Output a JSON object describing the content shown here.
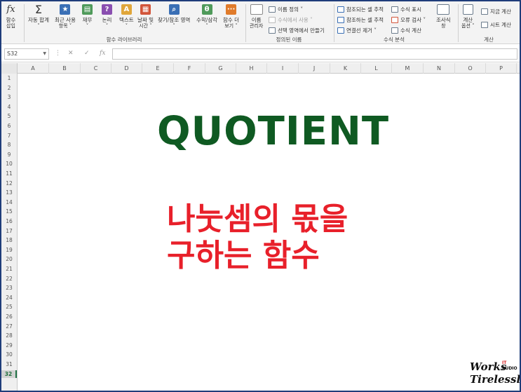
{
  "ribbon": {
    "function_library": {
      "insert_function": {
        "icon_label": "fx",
        "line1": "함수",
        "line2": "삽입"
      },
      "autosum": {
        "icon_label": "Σ",
        "line1": "자동 합계",
        "line2": "˅"
      },
      "recent": {
        "line1": "최근 사용",
        "line2": "항목 ˅"
      },
      "financial": {
        "line1": "재무",
        "line2": "˅"
      },
      "logical": {
        "icon_label": "?",
        "line1": "논리",
        "line2": "˅"
      },
      "text": {
        "line1": "텍스트",
        "line2": "˅"
      },
      "datetime": {
        "line1": "날짜 및",
        "line2": "시간 ˅"
      },
      "lookup": {
        "line1": "찾기/참조 영역",
        "line2": "˅"
      },
      "math": {
        "icon_label": "θ",
        "line1": "수학/삼각",
        "line2": "˅"
      },
      "more": {
        "line1": "함수 더",
        "line2": "보기 ˅"
      },
      "group_label": "함수 라이브러리"
    },
    "defined_names": {
      "name_manager": {
        "line1": "이름",
        "line2": "관리자"
      },
      "define_name": "이름 정의 ˅",
      "use_in_formula": "수식에서 사용 ˅",
      "create_from_selection": "선택 영역에서 만들기",
      "group_label": "정의된 이름"
    },
    "formula_auditing": {
      "trace_precedents": "참조되는 셀 추적",
      "trace_dependents": "참조하는 셀 추적",
      "remove_arrows": "연결선 제거 ˅",
      "show_formulas": "수식 표시",
      "error_checking": "오류 검사 ˅",
      "evaluate_formula": "수식 계산",
      "watch_window": {
        "line1": "조사식",
        "line2": "창"
      },
      "group_label": "수식 분석"
    },
    "calculation": {
      "calc_options": {
        "line1": "계산",
        "line2": "옵션 ˅"
      },
      "calc_now": "지금 계산",
      "calc_sheet": "시트 계산",
      "group_label": "계산"
    }
  },
  "formula_bar": {
    "name_box": "S32",
    "cancel_icon": "✕",
    "enter_icon": "✓",
    "fx_icon": "fx",
    "formula": ""
  },
  "columns": [
    "A",
    "B",
    "C",
    "D",
    "E",
    "F",
    "G",
    "H",
    "I",
    "J",
    "K",
    "L",
    "M",
    "N",
    "O",
    "P"
  ],
  "rows": [
    "1",
    "2",
    "3",
    "4",
    "5",
    "6",
    "7",
    "8",
    "9",
    "10",
    "11",
    "12",
    "13",
    "14",
    "15",
    "16",
    "17",
    "18",
    "19",
    "20",
    "21",
    "22",
    "23",
    "24",
    "25",
    "26",
    "27",
    "28",
    "29",
    "30",
    "31",
    "32"
  ],
  "selected_row": "32",
  "content": {
    "title": "QUOTIENT",
    "subtitle_line1": "나눗셈의 몫을",
    "subtitle_line2": "구하는 함수",
    "title_color": "#0f5a22",
    "subtitle_color": "#e8202a"
  },
  "logo": {
    "works": "Works",
    "it": "IT",
    "audio": "AUDIO",
    "tirelessly": "Tirelessly"
  }
}
